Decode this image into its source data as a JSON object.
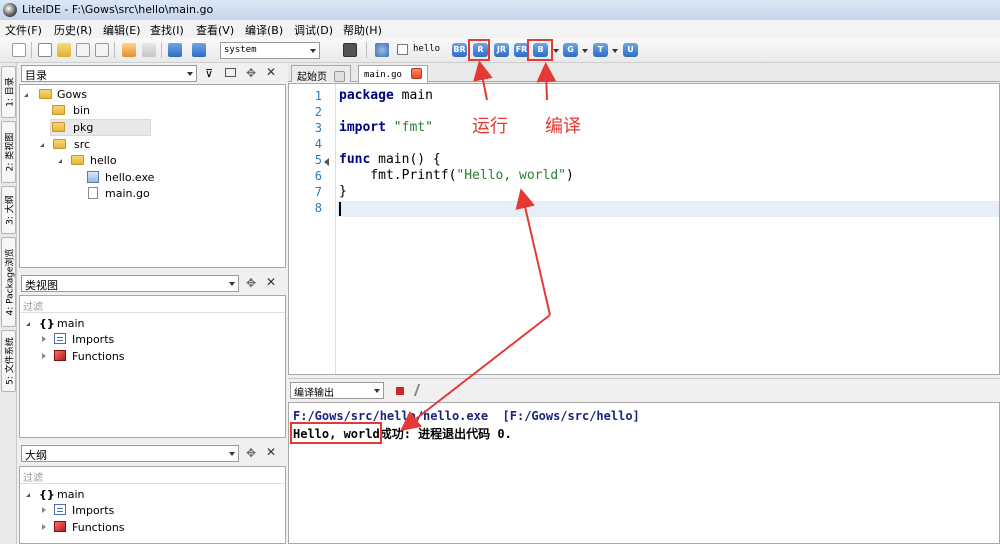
{
  "window": {
    "title": "LiteIDE - F:\\Gows\\src\\hello\\main.go"
  },
  "menu": [
    "文件(F)",
    "历史(R)",
    "编辑(E)",
    "查找(I)",
    "查看(V)",
    "编译(B)",
    "调试(D)",
    "帮助(H)"
  ],
  "toolbar": {
    "env_select": "system",
    "target_checkbox_label": "hello",
    "buttons": [
      "BR",
      "R",
      "JR",
      "FR",
      "B",
      "G",
      "T",
      "U"
    ]
  },
  "vtabs": [
    "1: 目录",
    "2: 类视图",
    "3: 大纲",
    "4: Package浏览",
    "5: 文件系统"
  ],
  "dir_panel": {
    "select": "目录",
    "tree": [
      {
        "label": "Gows"
      },
      {
        "label": "bin"
      },
      {
        "label": "pkg"
      },
      {
        "label": "src"
      },
      {
        "label": "hello"
      },
      {
        "label": "hello.exe"
      },
      {
        "label": "main.go"
      }
    ]
  },
  "class_panel": {
    "select": "类视图",
    "filter": "过滤",
    "tree": [
      {
        "label": "main"
      },
      {
        "label": "Imports"
      },
      {
        "label": "Functions"
      }
    ]
  },
  "outline_panel": {
    "select": "大纲",
    "filter": "过滤",
    "tree": [
      {
        "label": "main"
      },
      {
        "label": "Imports"
      },
      {
        "label": "Functions"
      }
    ]
  },
  "editor": {
    "tabs": [
      "起始页",
      "main.go"
    ],
    "line_numbers": [
      "1",
      "2",
      "3",
      "4",
      "5",
      "6",
      "7",
      "8"
    ],
    "code": {
      "l1_kw": "package",
      "l1_rest": " main",
      "l3_kw": "import",
      "l3_str": "\"fmt\"",
      "l5_kw": "func",
      "l5_rest": " main() {",
      "l6_pre": "    fmt.Printf(",
      "l6_str": "\"Hello, world\"",
      "l6_post": ")",
      "l7": "}"
    }
  },
  "annotations": {
    "run": "运行",
    "build": "编译"
  },
  "output": {
    "select": "编译输出",
    "lines": [
      "F:/Gows/src/hello/hello.exe  [F:/Gows/src/hello]",
      "Hello, world成功: 进程退出代码 0."
    ]
  },
  "colors": {
    "annotation": "#e53935",
    "toolbar_blue": "#2f6cc4"
  }
}
